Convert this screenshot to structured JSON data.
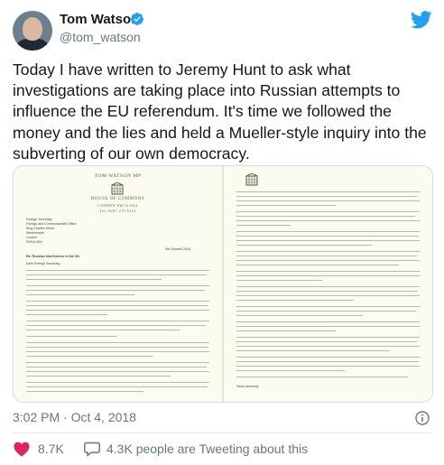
{
  "author": {
    "name": "Tom Watson",
    "handle": "@tom_watson"
  },
  "tweet": {
    "text": "Today I have written to Jeremy Hunt to ask what investigations are taking place into Russian attempts to influence the EU referendum. It's time we followed the money and the lies and held a Mueller-style inquiry into the subverting of our own democracy."
  },
  "letter": {
    "left_header": "TOM WATSON MP",
    "house": "HOUSE OF COMMONS",
    "city": "LONDON SW1A 0AA",
    "tel": "Tel: 0207 219 8123",
    "addressee": [
      "Foreign Secretary",
      "Foreign and Commonwealth Office",
      "King Charles Street",
      "Westminster",
      "London",
      "SW1A 2AH"
    ],
    "date": "4th October 2018",
    "subject": "Re: Russian interference in the UK",
    "salutation": "Dear Foreign Secretary,",
    "signoff": "Yours sincerely,"
  },
  "meta": {
    "time": "3:02 PM",
    "separator": "·",
    "date": "Oct 4, 2018"
  },
  "actions": {
    "likes": "8.7K",
    "talk": "4.3K people are Tweeting about this"
  },
  "colors": {
    "verified": "#1da1f2",
    "bird": "#1da1f2",
    "like": "#e0245e",
    "muted": "#657786"
  },
  "icons": [
    "verified-badge-icon",
    "twitter-bird-icon",
    "info-icon",
    "heart-icon",
    "speech-bubble-icon"
  ]
}
